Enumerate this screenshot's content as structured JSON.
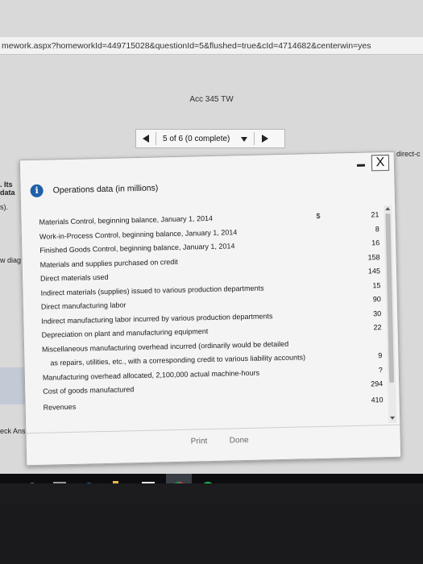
{
  "browser": {
    "url": "mework.aspx?homeworkId=449715028&questionId=5&flushed=true&cId=4714682&centerwin=yes"
  },
  "course": {
    "title": "Acc 345 TW"
  },
  "navigation": {
    "progress": "5 of 6 (0 complete)"
  },
  "background_fragments": {
    "direct": "direct-c",
    "its": ". Its",
    "data": "data",
    "s_paren": "s).",
    "w_diag": "w diag",
    "check_ans": "eck Ans"
  },
  "popup": {
    "title": "Operations data (in millions)",
    "close_label": "X",
    "print_label": "Print",
    "done_label": "Done",
    "rows": [
      {
        "label": "Materials Control, beginning balance, January 1, 2014",
        "currency": "$",
        "value": "21"
      },
      {
        "label": "Work-in-Process Control, beginning balance, January 1, 2014",
        "currency": "",
        "value": "8"
      },
      {
        "label": "Finished Goods Control, beginning balance, January 1, 2014",
        "currency": "",
        "value": "16"
      },
      {
        "label": "Materials and supplies purchased on credit",
        "currency": "",
        "value": "158"
      },
      {
        "label": "Direct materials used",
        "currency": "",
        "value": "145"
      },
      {
        "label": "Indirect materials (supplies) issued to various production departments",
        "currency": "",
        "value": "15"
      },
      {
        "label": "Direct manufacturing labor",
        "currency": "",
        "value": "90"
      },
      {
        "label": "Indirect manufacturing labor incurred by various production departments",
        "currency": "",
        "value": "30"
      },
      {
        "label": "Depreciation on plant and manufacturing equipment",
        "currency": "",
        "value": "22"
      },
      {
        "label": "Miscellaneous manufacturing overhead incurred (ordinarily would be detailed",
        "currency": "",
        "value": ""
      },
      {
        "label": "as repairs, utilities, etc., with a corresponding credit to various liability accounts)",
        "currency": "",
        "value": "9"
      },
      {
        "label": "Manufacturing overhead allocated, 2,100,000 actual machine-hours",
        "currency": "",
        "value": "?"
      },
      {
        "label": "Cost of goods manufactured",
        "currency": "",
        "value": "294"
      },
      {
        "label": "Revenues",
        "currency": "",
        "value": "410"
      }
    ]
  },
  "taskbar": {
    "edge_glyph": "e"
  }
}
